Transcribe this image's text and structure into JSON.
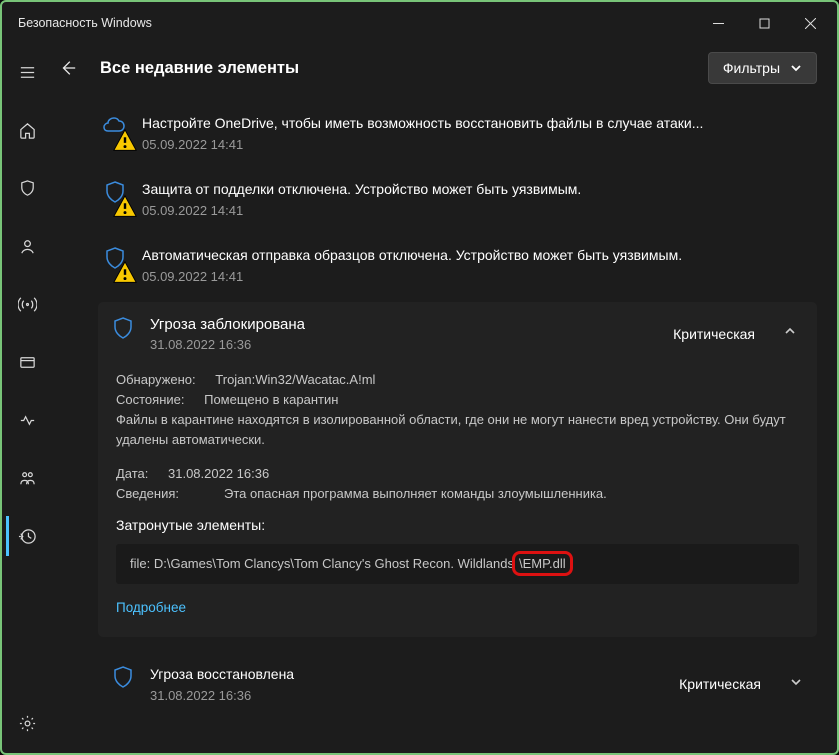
{
  "window": {
    "title": "Безопасность Windows"
  },
  "header": {
    "title": "Все недавние элементы",
    "filters": "Фильтры"
  },
  "items": [
    {
      "title": "Настройте OneDrive, чтобы иметь возможность восстановить файлы в случае атаки...",
      "date": "05.09.2022 14:41"
    },
    {
      "title": "Защита от подделки отключена. Устройство может быть уязвимым.",
      "date": "05.09.2022 14:41"
    },
    {
      "title": "Автоматическая отправка образцов отключена. Устройство может быть уязвимым.",
      "date": "05.09.2022 14:41"
    }
  ],
  "threat": {
    "title": "Угроза заблокирована",
    "date": "31.08.2022 16:36",
    "severity": "Критическая",
    "detected_lbl": "Обнаружено:",
    "detected_val": "Trojan:Win32/Wacatac.A!ml",
    "state_lbl": "Состояние:",
    "state_val": "Помещено в карантин",
    "desc": "Файлы в карантине находятся в изолированной области, где они не могут нанести вред устройству. Они будут удалены автоматически.",
    "date2_lbl": "Дата:",
    "date2_val": "31.08.2022 16:36",
    "info_lbl": "Сведения:",
    "info_val": "Эта опасная программа выполняет команды злоумышленника.",
    "affected_lbl": "Затронутые элементы:",
    "file_prefix": "file: D:\\Games\\Tom Clancys\\Tom Clancy's Ghost Recon. Wildlands",
    "file_hl": "\\EMP.dll",
    "more": "Подробнее"
  },
  "restored": {
    "title": "Угроза восстановлена",
    "date": "31.08.2022 16:36",
    "severity": "Критическая"
  }
}
